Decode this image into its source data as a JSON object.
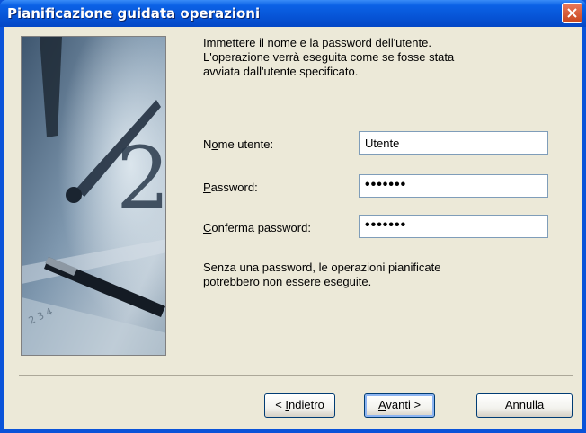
{
  "window": {
    "title": "Pianificazione guidata operazioni"
  },
  "intro": {
    "line1": "Immettere il nome e la password dell'utente.",
    "line2": "L'operazione verrà eseguita come se fosse stata",
    "line3": "avviata dall'utente specificato."
  },
  "form": {
    "username_label_prefix": "N",
    "username_label_accel": "o",
    "username_label_rest": "me utente:",
    "username_value": "Utente",
    "password_label_accel": "P",
    "password_label_rest": "assword:",
    "password_value": "•••••••",
    "confirm_label_accel": "C",
    "confirm_label_rest": "onferma password:",
    "confirm_value": "•••••••"
  },
  "note": {
    "line1": "Senza una password, le operazioni pianificate",
    "line2": "potrebbero non essere eseguite."
  },
  "buttons": {
    "back_prefix": "< ",
    "back_accel": "I",
    "back_rest": "ndietro",
    "next_accel": "A",
    "next_rest": "vanti >",
    "cancel": "Annulla"
  }
}
